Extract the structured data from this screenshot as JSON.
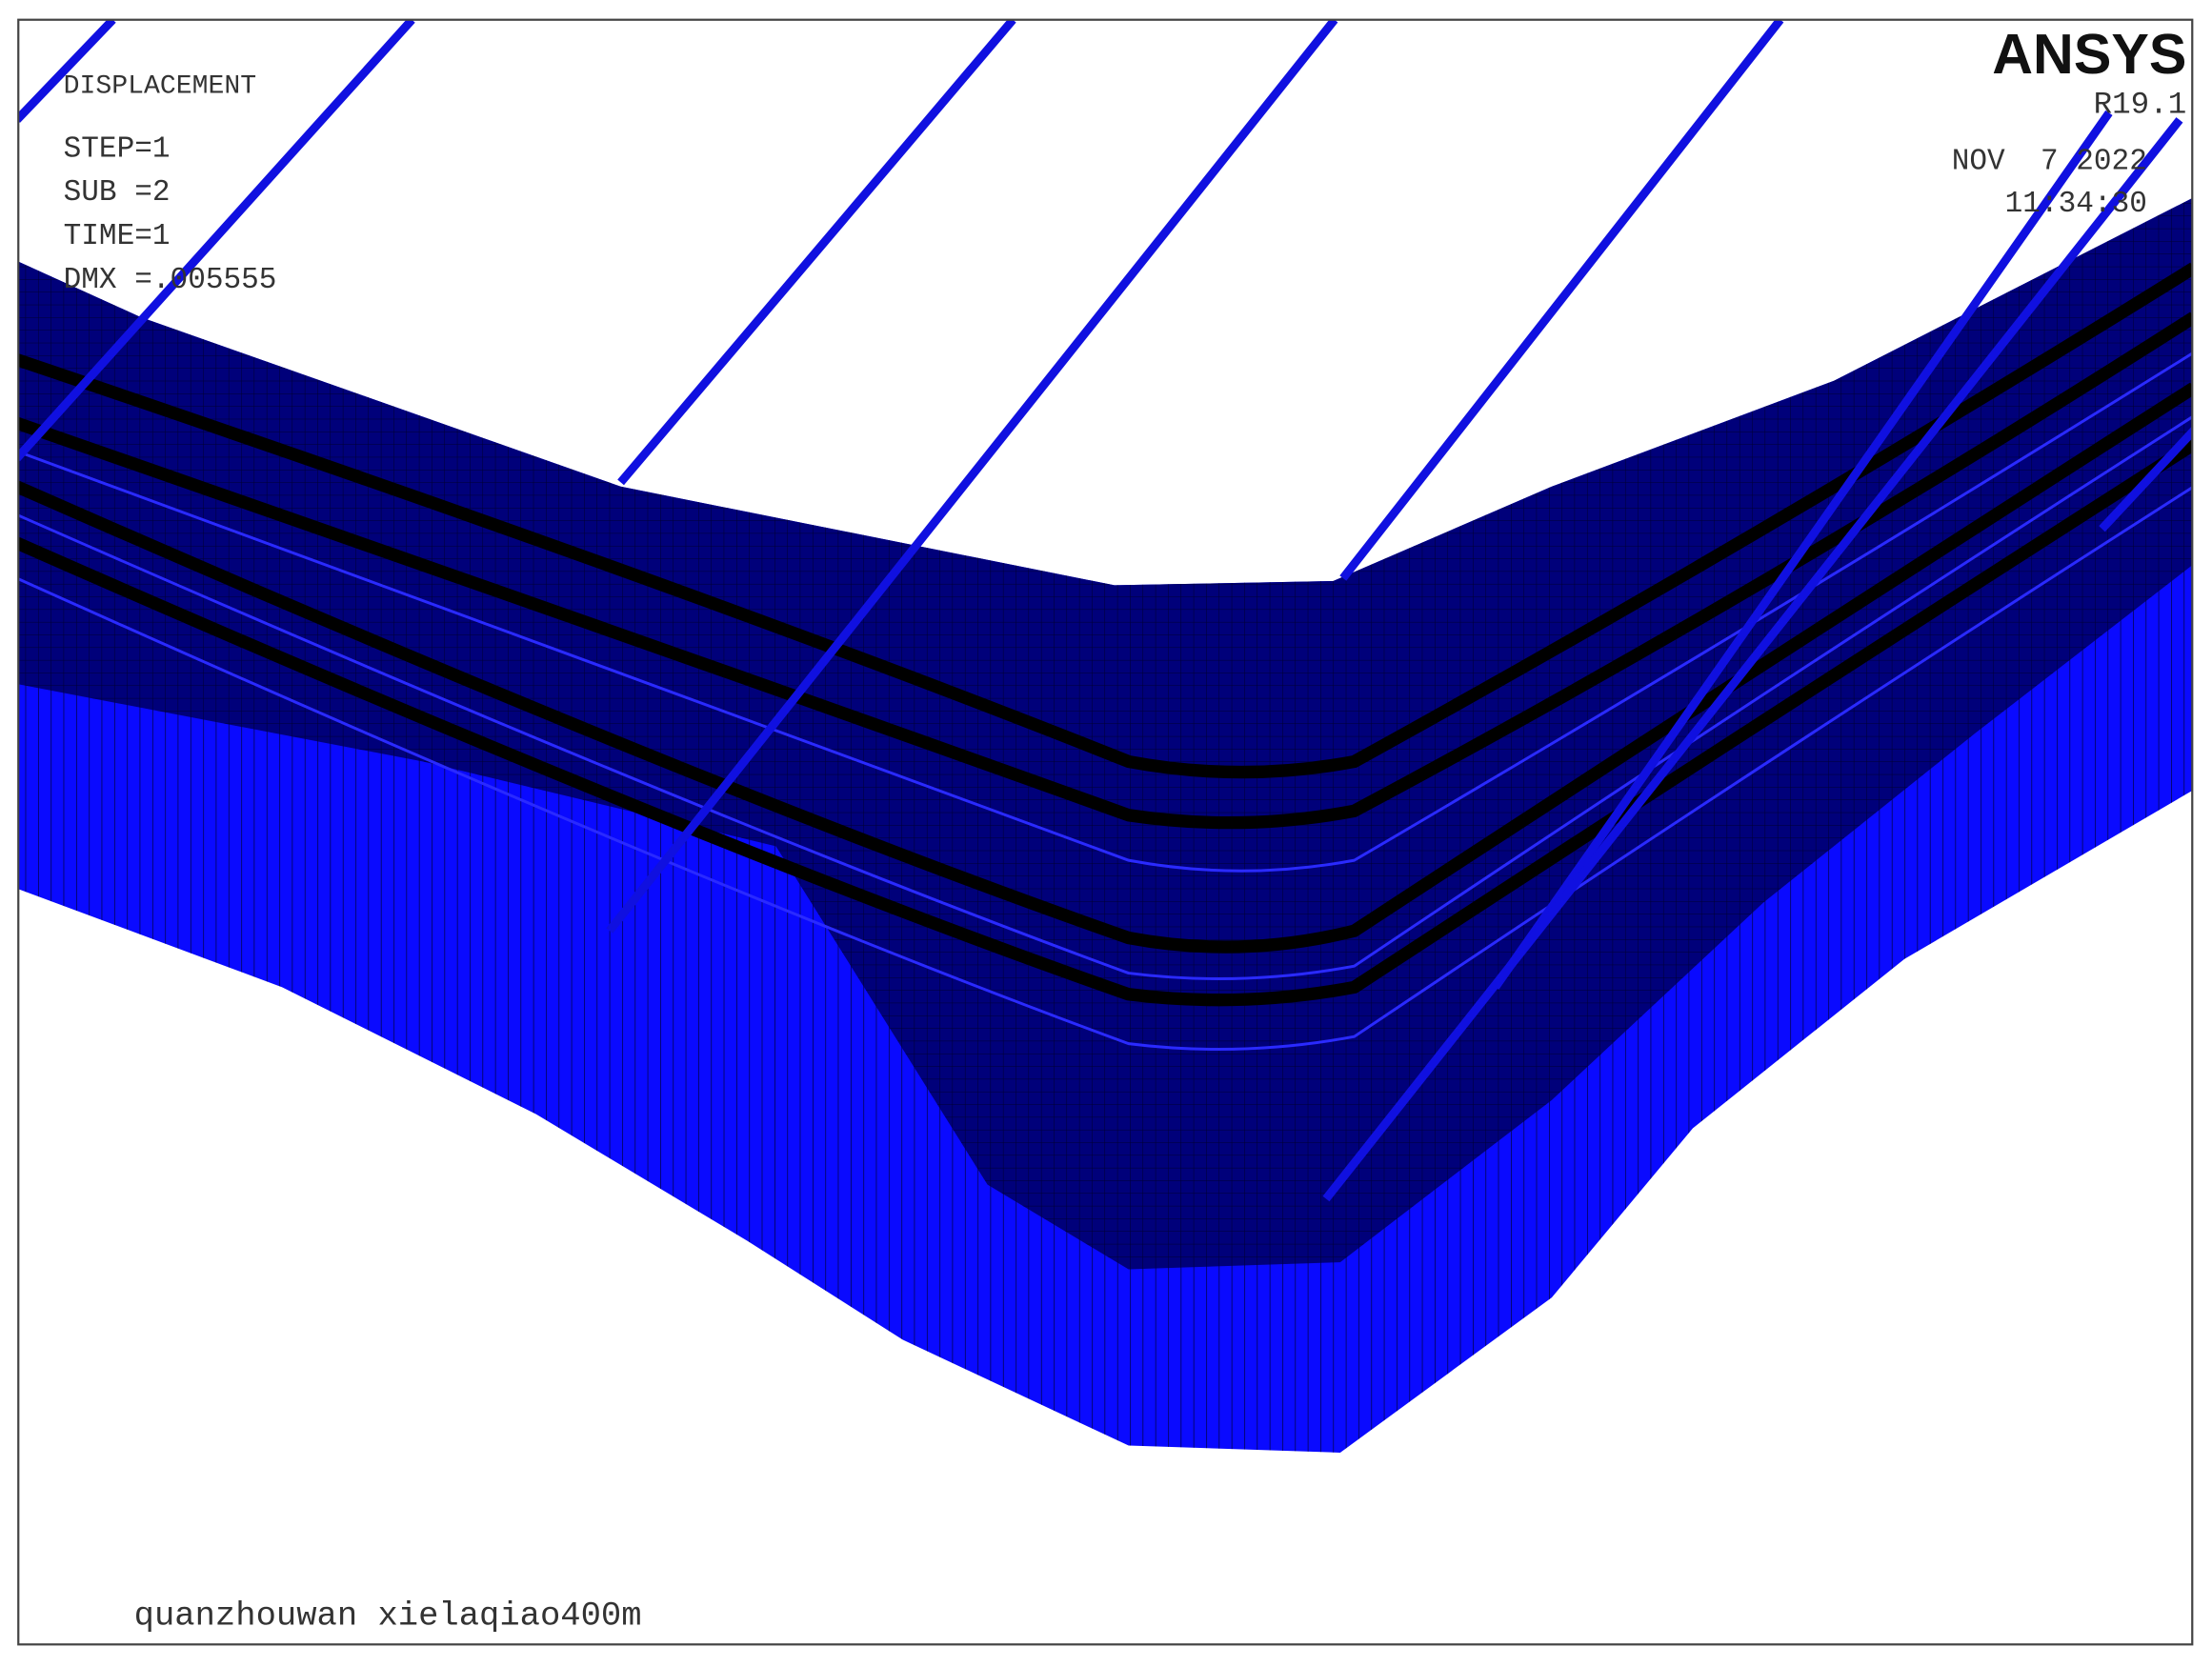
{
  "plot": {
    "result_type": "DISPLACEMENT",
    "step": "STEP=1",
    "sub": "SUB =2",
    "time": "TIME=1",
    "dmx": "DMX =.005555"
  },
  "branding": {
    "logo": "ANSYS",
    "version": "R19.1",
    "date": "NOV  7 2022",
    "time": "11:34:30"
  },
  "title": "quanzhouwan xielaqiao400m",
  "colors": {
    "mesh_dark": "#000080",
    "mesh_light": "#0000ff",
    "cable": "#1010e0",
    "layer_line": "#000000"
  }
}
